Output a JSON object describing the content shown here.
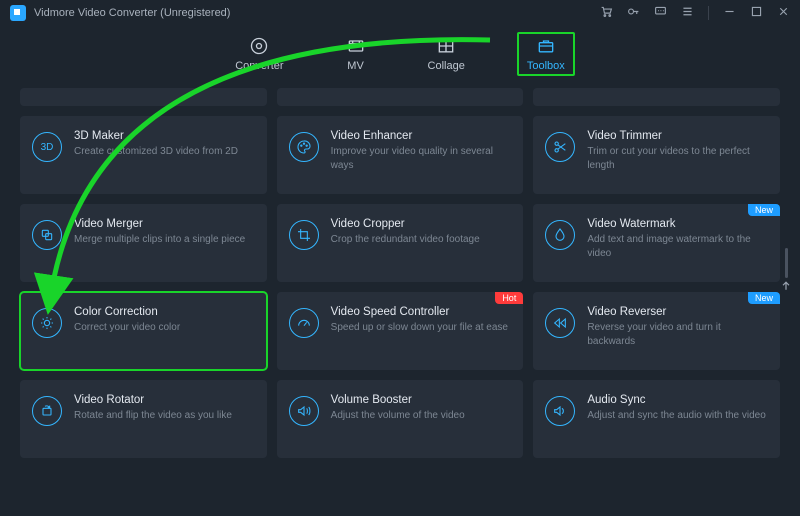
{
  "app": {
    "title": "Vidmore Video Converter (Unregistered)"
  },
  "tabs": {
    "converter": "Converter",
    "mv": "MV",
    "collage": "Collage",
    "toolbox": "Toolbox"
  },
  "badges": {
    "hot": "Hot",
    "new": "New"
  },
  "tools": {
    "maker3d": {
      "title": "3D Maker",
      "desc": "Create customized 3D video from 2D"
    },
    "enhancer": {
      "title": "Video Enhancer",
      "desc": "Improve your video quality in several ways"
    },
    "trimmer": {
      "title": "Video Trimmer",
      "desc": "Trim or cut your videos to the perfect length"
    },
    "merger": {
      "title": "Video Merger",
      "desc": "Merge multiple clips into a single piece"
    },
    "cropper": {
      "title": "Video Cropper",
      "desc": "Crop the redundant video footage"
    },
    "watermark": {
      "title": "Video Watermark",
      "desc": "Add text and image watermark to the video"
    },
    "color": {
      "title": "Color Correction",
      "desc": "Correct your video color"
    },
    "speed": {
      "title": "Video Speed Controller",
      "desc": "Speed up or slow down your file at ease"
    },
    "reverser": {
      "title": "Video Reverser",
      "desc": "Reverse your video and turn it backwards"
    },
    "rotator": {
      "title": "Video Rotator",
      "desc": "Rotate and flip the video as you like"
    },
    "volume": {
      "title": "Volume Booster",
      "desc": "Adjust the volume of the video"
    },
    "audiosync": {
      "title": "Audio Sync",
      "desc": "Adjust and sync the audio with the video"
    }
  }
}
